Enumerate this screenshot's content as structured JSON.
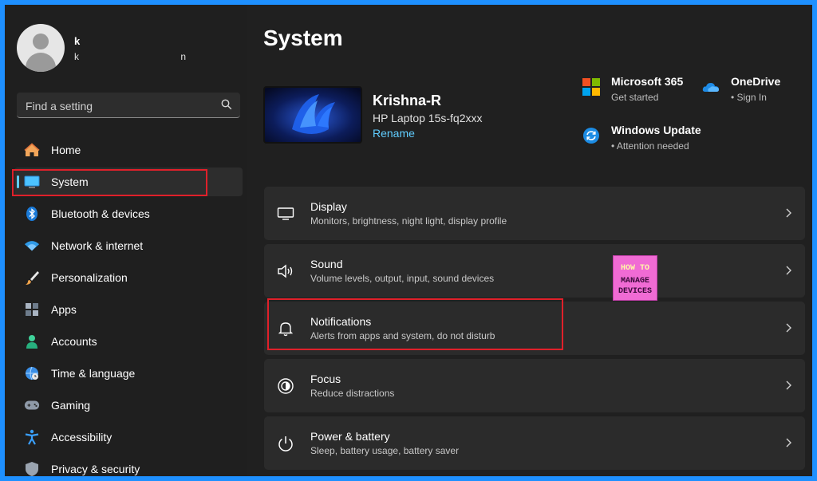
{
  "user": {
    "name": "k",
    "email_start": "k",
    "email_end": "n"
  },
  "search": {
    "placeholder": "Find a setting"
  },
  "nav": {
    "items": [
      {
        "label": "Home"
      },
      {
        "label": "System"
      },
      {
        "label": "Bluetooth & devices"
      },
      {
        "label": "Network & internet"
      },
      {
        "label": "Personalization"
      },
      {
        "label": "Apps"
      },
      {
        "label": "Accounts"
      },
      {
        "label": "Time & language"
      },
      {
        "label": "Gaming"
      },
      {
        "label": "Accessibility"
      },
      {
        "label": "Privacy & security"
      }
    ]
  },
  "main": {
    "title": "System",
    "device": {
      "name": "Krishna-R",
      "model": "HP Laptop 15s-fq2xxx",
      "rename": "Rename"
    },
    "quick": {
      "m365": {
        "title": "Microsoft 365",
        "sub": "Get started"
      },
      "onedrive": {
        "title": "OneDrive",
        "sub": "• Sign In"
      },
      "update": {
        "title": "Windows Update",
        "sub": "• Attention needed"
      }
    },
    "cards": [
      {
        "title": "Display",
        "sub": "Monitors, brightness, night light, display profile",
        "icon": "monitor-icon"
      },
      {
        "title": "Sound",
        "sub": "Volume levels, output, input, sound devices",
        "icon": "speaker-icon"
      },
      {
        "title": "Notifications",
        "sub": "Alerts from apps and system, do not disturb",
        "icon": "bell-icon"
      },
      {
        "title": "Focus",
        "sub": "Reduce distractions",
        "icon": "focus-icon"
      },
      {
        "title": "Power & battery",
        "sub": "Sleep, battery usage, battery saver",
        "icon": "power-icon"
      }
    ]
  },
  "watermark": {
    "line1": "HOW TO",
    "line2": "MANAGE",
    "line3": "DEVICES"
  },
  "colors": {
    "accent": "#60cdff",
    "highlight": "#e0202a",
    "background": "#202020",
    "card": "#2b2b2b",
    "outer_border": "#1e90ff"
  }
}
